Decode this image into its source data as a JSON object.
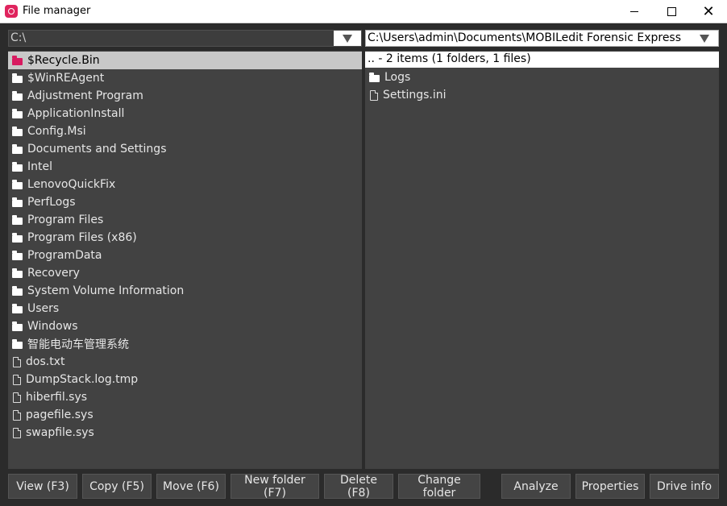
{
  "window": {
    "title": "File manager"
  },
  "left": {
    "path": "C:\\",
    "items": [
      {
        "name": "$Recycle.Bin",
        "type": "folder",
        "selected": true
      },
      {
        "name": "$WinREAgent",
        "type": "folder"
      },
      {
        "name": "Adjustment Program",
        "type": "folder"
      },
      {
        "name": "ApplicationInstall",
        "type": "folder"
      },
      {
        "name": "Config.Msi",
        "type": "folder"
      },
      {
        "name": "Documents and Settings",
        "type": "folder"
      },
      {
        "name": "Intel",
        "type": "folder"
      },
      {
        "name": "LenovoQuickFix",
        "type": "folder"
      },
      {
        "name": "PerfLogs",
        "type": "folder"
      },
      {
        "name": "Program Files",
        "type": "folder"
      },
      {
        "name": "Program Files (x86)",
        "type": "folder"
      },
      {
        "name": "ProgramData",
        "type": "folder"
      },
      {
        "name": "Recovery",
        "type": "folder"
      },
      {
        "name": "System Volume Information",
        "type": "folder"
      },
      {
        "name": "Users",
        "type": "folder"
      },
      {
        "name": "Windows",
        "type": "folder"
      },
      {
        "name": "智能电动车管理系统",
        "type": "folder"
      },
      {
        "name": "dos.txt",
        "type": "file"
      },
      {
        "name": "DumpStack.log.tmp",
        "type": "file"
      },
      {
        "name": "hiberfil.sys",
        "type": "file"
      },
      {
        "name": "pagefile.sys",
        "type": "file"
      },
      {
        "name": "swapfile.sys",
        "type": "file"
      }
    ]
  },
  "right": {
    "path": "C:\\Users\\admin\\Documents\\MOBILedit Forensic Express",
    "summary": ".. - 2 items (1 folders, 1 files)",
    "items": [
      {
        "name": "Logs",
        "type": "folder"
      },
      {
        "name": "Settings.ini",
        "type": "file"
      }
    ]
  },
  "buttons": {
    "view": "View (F3)",
    "copy": "Copy (F5)",
    "move": "Move (F6)",
    "new_folder": "New folder (F7)",
    "delete": "Delete (F8)",
    "change_folder": "Change folder",
    "analyze": "Analyze",
    "properties": "Properties",
    "drive_info": "Drive info"
  },
  "colors": {
    "selection": "#c8c8c8",
    "accent": "#d81b60",
    "panel": "#424242"
  }
}
